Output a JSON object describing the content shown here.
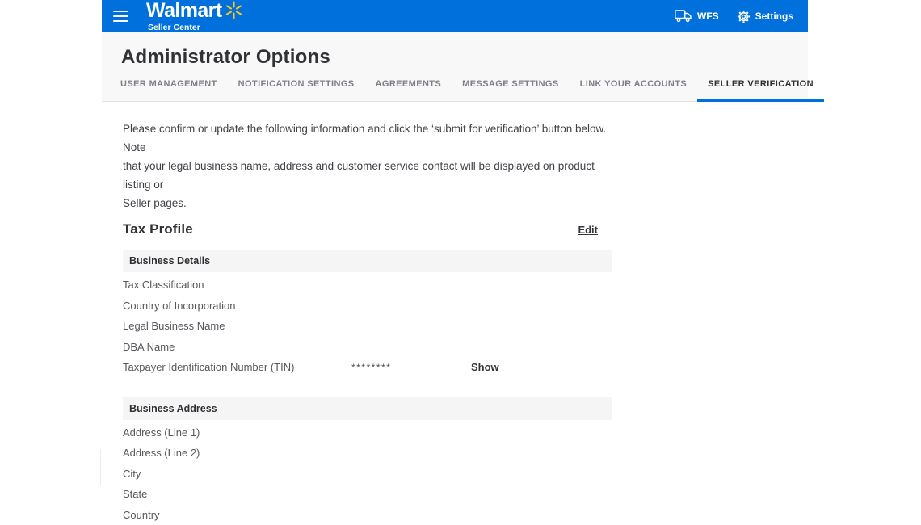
{
  "topbar": {
    "brand_name": "Walmart",
    "brand_subtitle": "Seller Center",
    "wfs_label": "WFS",
    "settings_label": "Settings"
  },
  "icons": {
    "menu": "hamburger-icon",
    "brand_spark": "walmart-spark-icon",
    "wfs": "truck-icon",
    "settings": "gear-icon"
  },
  "colors": {
    "topbar_blue": "#0071dc",
    "spark_yellow": "#ffc220",
    "active_tab_underline": "#0071dc",
    "pagehead_background": "#f8f8f8",
    "section_bar_background": "#f5f5f6"
  },
  "header": {
    "title": "Administrator Options",
    "tabs": [
      {
        "label": "USER MANAGEMENT",
        "active": false
      },
      {
        "label": "NOTIFICATION SETTINGS",
        "active": false
      },
      {
        "label": "AGREEMENTS",
        "active": false
      },
      {
        "label": "MESSAGE SETTINGS",
        "active": false
      },
      {
        "label": "LINK YOUR ACCOUNTS",
        "active": false
      },
      {
        "label": "SELLER VERIFICATION",
        "active": true
      }
    ]
  },
  "main": {
    "intro": "Please confirm or update the following information and click the ‘submit for verification’ button below. Note\nthat your legal business name, address and customer service contact will be displayed on product listing or\nSeller pages.",
    "tax_profile": {
      "title": "Tax Profile",
      "edit_label": "Edit"
    },
    "business_details": {
      "header": "Business Details",
      "rows": [
        {
          "label": "Tax Classification"
        },
        {
          "label": "Country of Incorporation"
        },
        {
          "label": "Legal Business Name"
        },
        {
          "label": "DBA Name"
        },
        {
          "label": "Taxpayer Identification Number (TIN)",
          "value": "********",
          "action_label": "Show"
        }
      ]
    },
    "business_address": {
      "header": "Business Address",
      "rows": [
        {
          "label": "Address (Line 1)"
        },
        {
          "label": "Address (Line 2)"
        },
        {
          "label": "City"
        },
        {
          "label": "State"
        },
        {
          "label": "Country"
        }
      ]
    }
  }
}
